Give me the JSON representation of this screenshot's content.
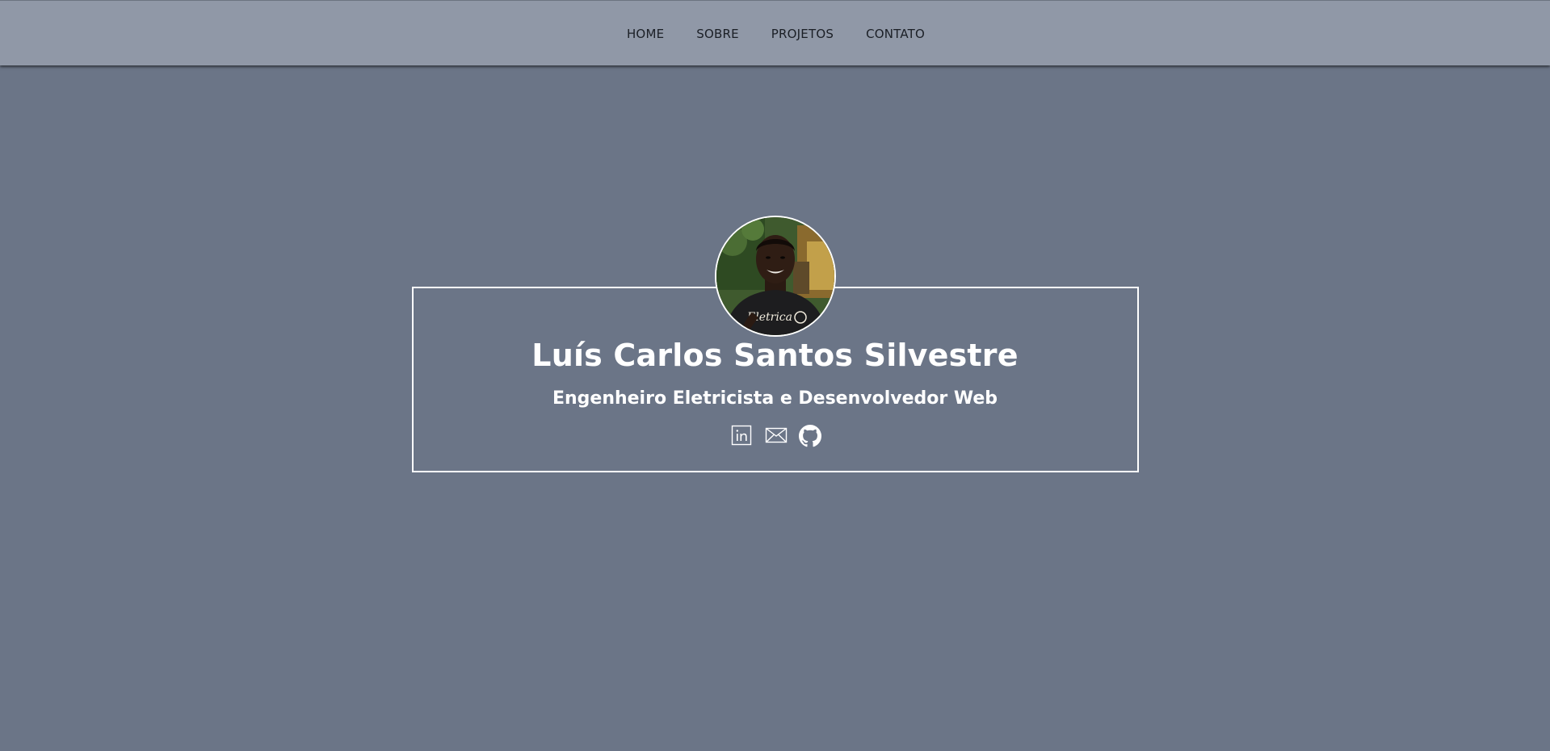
{
  "nav": {
    "items": [
      {
        "label": "HOME"
      },
      {
        "label": "SOBRE"
      },
      {
        "label": "PROJETOS"
      },
      {
        "label": "CONTATO"
      }
    ]
  },
  "profile": {
    "name": "Luís Carlos Santos Silvestre",
    "role": "Engenheiro Eletricista e Desenvolvedor Web",
    "avatar_shirt_text": "Eletrica",
    "social": [
      {
        "icon": "linkedin-icon"
      },
      {
        "icon": "mail-icon"
      },
      {
        "icon": "github-icon"
      }
    ]
  },
  "colors": {
    "background": "#6b7587",
    "navbar": "#9098a7",
    "text": "#ffffff",
    "nav_text": "#1b1f26"
  }
}
